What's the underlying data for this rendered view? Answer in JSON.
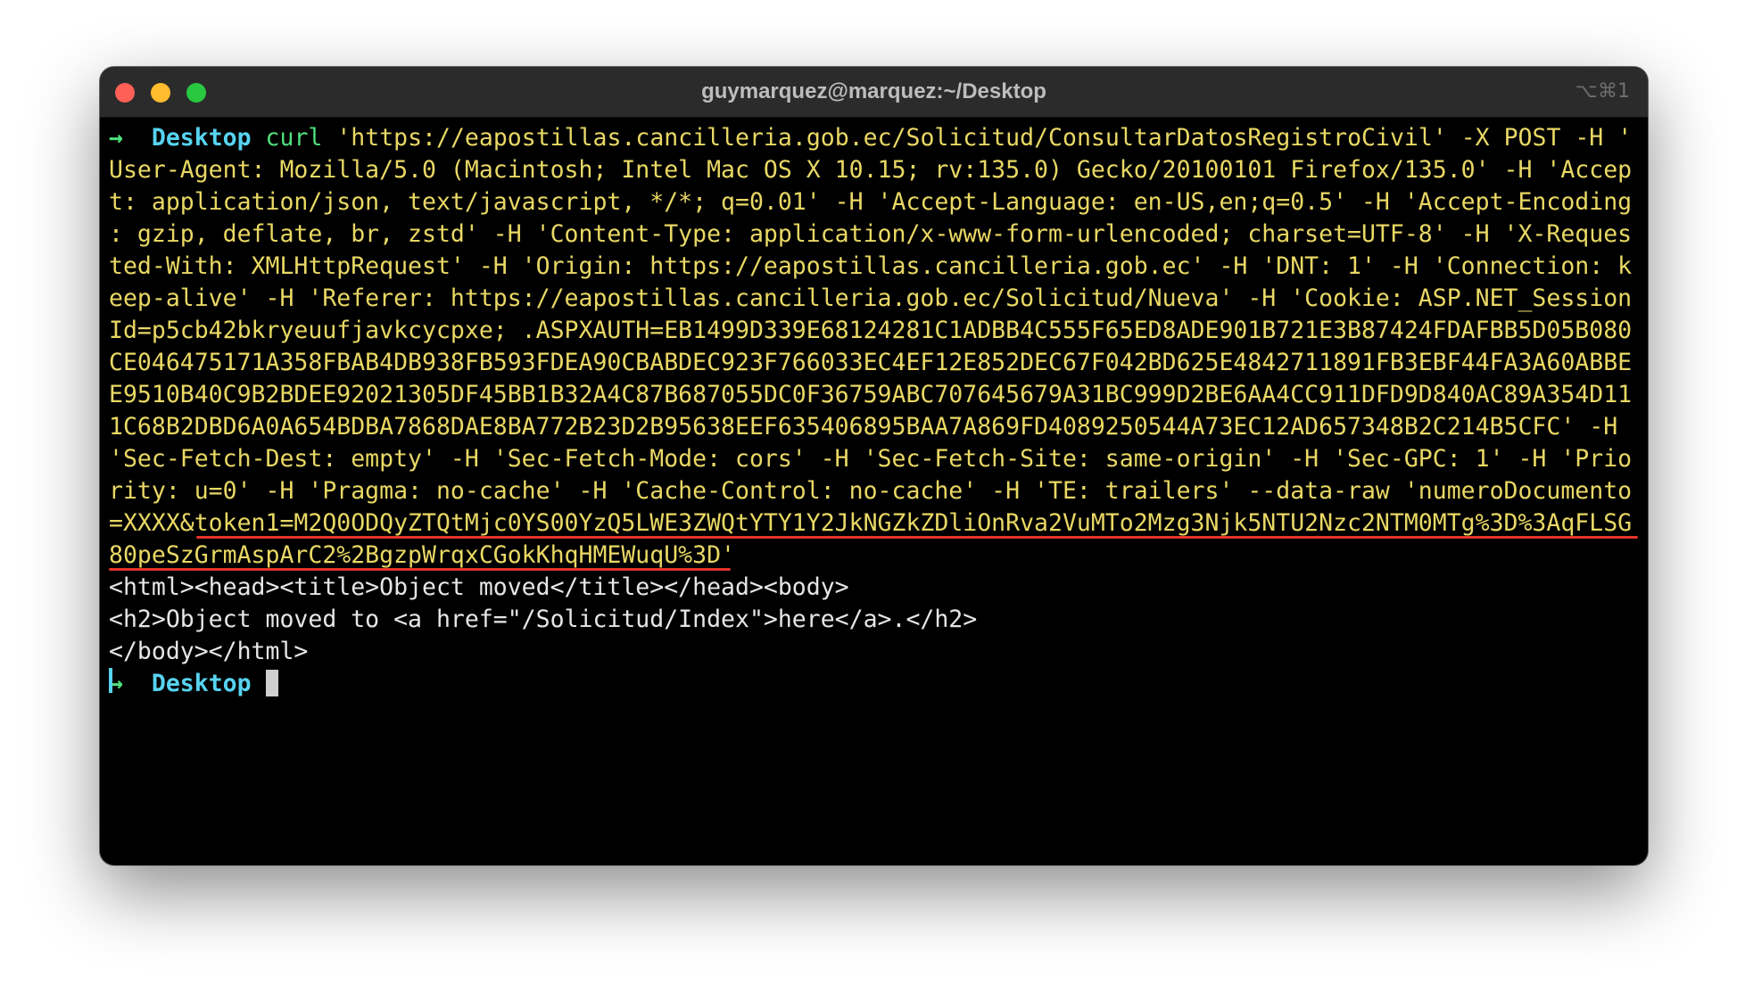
{
  "window": {
    "title": "guymarquez@marquez:~/Desktop",
    "shortcut": "⌥⌘1"
  },
  "prompt": {
    "arrow": "→",
    "directory": "Desktop",
    "command": "curl"
  },
  "command_lines": [
    " 'https://eapostillas.cancilleria.gob.ec/Solicitud/ConsultarDatosRegistroCivil' -X POST -H '",
    "User-Agent: Mozilla/5.0 (Macintosh; Intel Mac OS X 10.15; rv:135.0) Gecko/20100101 Firefox/135.0' -H 'Accep",
    "t: application/json, text/javascript, */*; q=0.01' -H 'Accept-Language: en-US,en;q=0.5' -H 'Accept-Encoding",
    ": gzip, deflate, br, zstd' -H 'Content-Type: application/x-www-form-urlencoded; charset=UTF-8' -H 'X-Reques",
    "ted-With: XMLHttpRequest' -H 'Origin: https://eapostillas.cancilleria.gob.ec' -H 'DNT: 1' -H 'Connection: k",
    "eep-alive' -H 'Referer: https://eapostillas.cancilleria.gob.ec/Solicitud/Nueva' -H 'Cookie: ASP.NET_Session",
    "Id=p5cb42bkryeuufjavkcycpxe; .ASPXAUTH=EB1499D339E68124281C1ADBB4C555F65ED8ADE901B721E3B87424FDAFBB5D05B080",
    "CE046475171A358FBAB4DB938FB593FDEA90CBABDEC923F766033EC4EF12E852DEC67F042BD625E4842711891FB3EBF44FA3A60ABBE",
    "E9510B40C9B2BDEE92021305DF45BB1B32A4C87B687055DC0F36759ABC707645679A31BC999D2BE6AA4CC911DFD9D840AC89A354D11",
    "1C68B2DBD6A0A654BDBA7868DAE8BA772B23D2B95638EEF635406895BAA7A869FD4089250544A73EC12AD657348B2C214B5CFC' -H",
    "'Sec-Fetch-Dest: empty' -H 'Sec-Fetch-Mode: cors' -H 'Sec-Fetch-Site: same-origin' -H 'Sec-GPC: 1' -H 'Prio",
    "rity: u=0' -H 'Pragma: no-cache' -H 'Cache-Control: no-cache' -H 'TE: trailers' --data-raw 'numeroDocumento",
    "=XXXX&token1=M2Q0ODQyZTQtMjc0YS00YzQ5LWE3ZWQtYTY1Y2JkNGZkZDliOnRva2VuMTo2Mzg3Njk5NTU2Nzc2NTM0MTg%3D%3AqFLSG",
    "80peSzGrmAspArC2%2BgzpWrqxCGokKhqHMEWuqU%3D'"
  ],
  "output_lines": [
    "<html><head><title>Object moved</title></head><body>",
    "<h2>Object moved to <a href=\"/Solicitud/Index\">here</a>.</h2>",
    "</body></html>"
  ],
  "colors": {
    "prompt_arrow": "#4fe07d",
    "directory": "#57d3f0",
    "command_text": "#e9d864",
    "output_text": "#e6e6e6",
    "token_underline": "#e6332a"
  }
}
